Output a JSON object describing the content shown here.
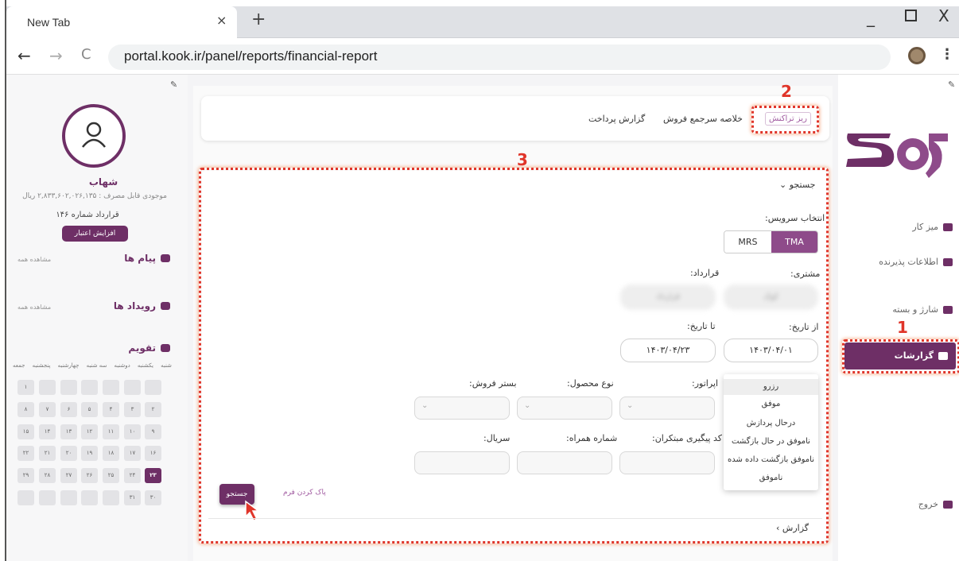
{
  "browser": {
    "tab_title": "New Tab",
    "tab_close": "×",
    "new_tab": "+",
    "url": "portal.kook.ir/panel/reports/financial-report",
    "back": "←",
    "forward": "→",
    "reload": "C",
    "menu": "⋮",
    "win_min": "_",
    "win_close": "X"
  },
  "left_panel": {
    "username": "شهاب",
    "balance": "موجودی قابل مصرف : ۲,۸۳۳,۶۰۲,۰۲۶,۱۳۵ ریال",
    "contract": "قرارداد شماره ۱۴۶",
    "credit_button": "افزایش اعتبار",
    "messages_title": "پیام ها",
    "messages_more": "مشاهده همه",
    "events_title": "رویداد ها",
    "events_more": "مشاهده همه",
    "calendar_title": "تقویم",
    "weekdays": [
      "شنبه",
      "یکشنبه",
      "دوشنبه",
      "سه شنبه",
      "چهارشنبه",
      "پنجشنبه",
      "جمعه"
    ],
    "calendar_rows": [
      [
        "",
        "",
        "",
        "",
        "",
        "",
        "۱"
      ],
      [
        "۲",
        "۳",
        "۴",
        "۵",
        "۶",
        "۷",
        "۸"
      ],
      [
        "۹",
        "۱۰",
        "۱۱",
        "۱۲",
        "۱۳",
        "۱۴",
        "۱۵"
      ],
      [
        "۱۶",
        "۱۷",
        "۱۸",
        "۱۹",
        "۲۰",
        "۲۱",
        "۲۲"
      ],
      [
        "۲۳",
        "۲۴",
        "۲۵",
        "۲۶",
        "۲۷",
        "۲۸",
        "۲۹"
      ],
      [
        "۳۰",
        "۳۱",
        "",
        "",
        "",
        "",
        ""
      ]
    ],
    "today": "۲۳"
  },
  "right_panel": {
    "nav": [
      {
        "label": "میز کار"
      },
      {
        "label": "اطلاعات پذیرنده"
      },
      {
        "label": "شارژ و بسته"
      },
      {
        "label": "گزارشات"
      },
      {
        "label": "خروج"
      }
    ]
  },
  "tabs": [
    {
      "label": "ریز تراکنش"
    },
    {
      "label": "خلاصه سرجمع فروش"
    },
    {
      "label": "گزارش پرداخت"
    }
  ],
  "search": {
    "section_title": "جستجو",
    "service_label": "انتخاب سرویس:",
    "service_options": [
      "TMA",
      "MRS"
    ],
    "customer_label": "مشتری:",
    "contract_label": "قرارداد:",
    "customer_value": "کوک",
    "contract_value": "قرارداد",
    "from_date_label": "از تاریخ:",
    "to_date_label": "تا تاریخ:",
    "from_date": "۱۴۰۳/۰۴/۰۱",
    "to_date": "۱۴۰۳/۰۴/۲۳",
    "operator_label": "اپراتور:",
    "product_label": "نوع محصول:",
    "sales_platform_label": "بستر فروش:",
    "tracking_label": "کد پیگیری مبتکران:",
    "mobile_label": "شماره همراه:",
    "serial_label": "سریال:",
    "status_options": [
      "رزرو",
      "موفق",
      "درحال پردازش",
      "ناموفق در حال بازگشت",
      "ناموفق بازگشت داده شده",
      "ناموفق"
    ],
    "clear_button": "پاک کردن فرم",
    "search_button": "جستجو",
    "report_title": "گزارش"
  },
  "annotations": [
    {
      "number": "1"
    },
    {
      "number": "2"
    },
    {
      "number": "3"
    }
  ],
  "colors": {
    "brand": "#6e2f66",
    "accent": "#8e4b8a",
    "annotation": "#e0352a"
  }
}
